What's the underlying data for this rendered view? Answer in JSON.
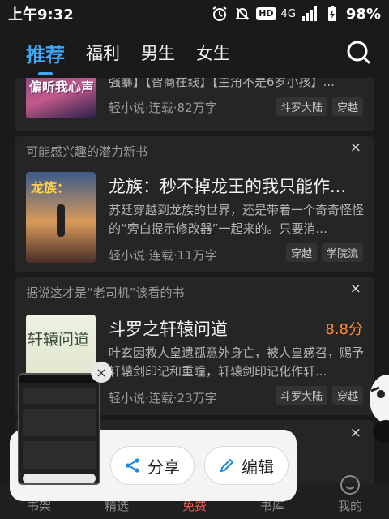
{
  "status_bar": {
    "time": "上午9:32",
    "hd": "HD",
    "network": "4G",
    "battery": "98%"
  },
  "top_tabs": [
    "推荐",
    "福利",
    "男生",
    "女生"
  ],
  "feed": {
    "book0": {
      "cover_text": "偏听我心声",
      "desc": "强暴】【智商在线】【主角不是6岁小孩】...",
      "meta": "轻小说·连载·82万字",
      "tags": [
        "斗罗大陆",
        "穿越"
      ]
    },
    "section1": {
      "title": "可能感兴趣的潜力新书",
      "close": "×"
    },
    "book1": {
      "cover_text": "龙族：",
      "title": "龙族：秒不掉龙王的我只能作...",
      "desc": "苏廷穿越到龙族的世界，还是带着一个奇奇怪怪的“旁白提示修改器”一起来的。只要消...",
      "meta": "轻小说·连载·11万字",
      "tags": [
        "穿越",
        "学院流"
      ]
    },
    "section2": {
      "title": "据说这才是“老司机”该看的书",
      "close": "×"
    },
    "book2": {
      "cover_text": "轩辕问道",
      "title": "斗罗之轩辕问道",
      "score": "8.8分",
      "desc": "叶玄因救人皇遗孤意外身亡，被人皇感召，赐予轩辕剑印记和重瞳，轩辕剑印记化作轩...",
      "meta": "轻小说·连载·23万字",
      "tags": [
        "斗罗大陆",
        "穿越"
      ]
    },
    "section3": {
      "close": "×"
    }
  },
  "bottom_nav": [
    "书架",
    "精选",
    "免费",
    "书库",
    "我的"
  ],
  "share_popup": {
    "share_label": "分享",
    "edit_label": "编辑",
    "close": "×"
  },
  "colors": {
    "accent": "#3fa9f5",
    "score": "#ff8a3d",
    "active_bottom": "#ff5a4a"
  }
}
